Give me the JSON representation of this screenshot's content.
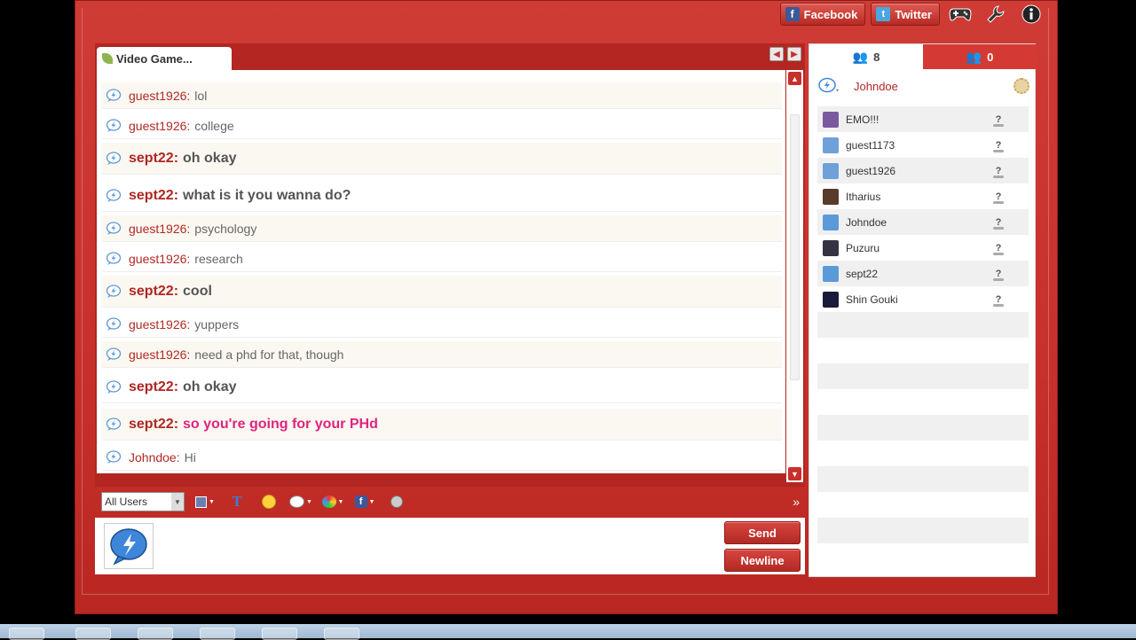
{
  "topbar": {
    "facebook_label": "Facebook",
    "twitter_label": "Twitter"
  },
  "room_tab": {
    "label": "Video Game..."
  },
  "messages": [
    {
      "user": "guest1926",
      "text": "lol",
      "style": "normal"
    },
    {
      "user": "guest1926",
      "text": "college",
      "style": "normal"
    },
    {
      "user": "sept22",
      "text": "oh okay",
      "style": "big"
    },
    {
      "user": "sept22",
      "text": "what is it you wanna do?",
      "style": "big"
    },
    {
      "user": "guest1926",
      "text": "psychology",
      "style": "normal"
    },
    {
      "user": "guest1926",
      "text": "research",
      "style": "normal"
    },
    {
      "user": "sept22",
      "text": "cool",
      "style": "big"
    },
    {
      "user": "guest1926",
      "text": "yuppers",
      "style": "normal"
    },
    {
      "user": "guest1926",
      "text": "need a phd for that, though",
      "style": "normal"
    },
    {
      "user": "sept22",
      "text": "oh okay",
      "style": "big"
    },
    {
      "user": "sept22",
      "text": "so you're going for your PHd",
      "style": "pink"
    },
    {
      "user": "Johndoe",
      "text": "Hi",
      "style": "normal"
    }
  ],
  "toolbar": {
    "recipient_select": "All Users"
  },
  "composer": {
    "value": "",
    "send_label": "Send",
    "newline_label": "Newline"
  },
  "userlist": {
    "online_count": "8",
    "other_count": "0",
    "current_user": "Johndoe",
    "users": [
      {
        "name": "EMO!!!",
        "avatar": "#7a5a9e"
      },
      {
        "name": "guest1173",
        "avatar": "#6fa0d8"
      },
      {
        "name": "guest1926",
        "avatar": "#6fa0d8"
      },
      {
        "name": "Itharius",
        "avatar": "#5a3a2a"
      },
      {
        "name": "Johndoe",
        "avatar": "#5a9ad8"
      },
      {
        "name": "Puzuru",
        "avatar": "#333344"
      },
      {
        "name": "sept22",
        "avatar": "#5a9ad8"
      },
      {
        "name": "Shin Gouki",
        "avatar": "#1a1a3a"
      }
    ]
  },
  "colors": {
    "brand": "#c8302b",
    "username": "#b12a24",
    "pink_text": "#e0237f"
  }
}
